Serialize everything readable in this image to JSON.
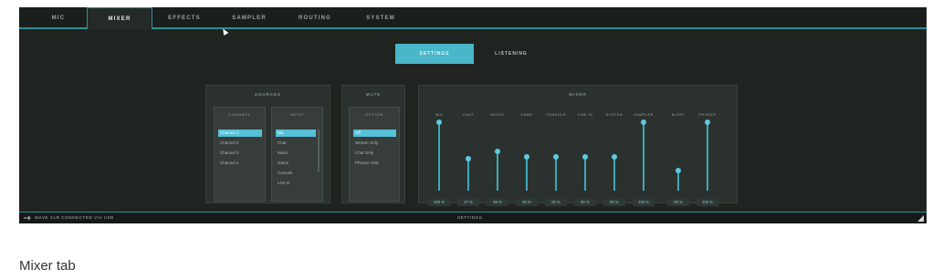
{
  "tabs": [
    {
      "label": "MIC",
      "active": false
    },
    {
      "label": "MIXER",
      "active": true
    },
    {
      "label": "EFFECTS",
      "active": false
    },
    {
      "label": "SAMPLER",
      "active": false
    },
    {
      "label": "ROUTING",
      "active": false
    },
    {
      "label": "SYSTEM",
      "active": false
    }
  ],
  "modes": {
    "settings": "SETTINGS",
    "listening": "LISTENING"
  },
  "panels": {
    "sources": {
      "title": "SOURCES",
      "channel": {
        "title": "CHANNEL",
        "items": [
          "Channel 1",
          "Channel 2",
          "Channel 3",
          "Channel 4"
        ]
      },
      "input": {
        "title": "INPUT",
        "items": [
          "Mic",
          "Chat",
          "Music",
          "Game",
          "Console",
          "Line In"
        ]
      }
    },
    "mute": {
      "title": "MUTE",
      "option": {
        "title": "OPTION",
        "items": [
          "Off",
          "Stream Only",
          "Chat Only",
          "Phones Only"
        ]
      }
    },
    "mixer": {
      "title": "MIXER",
      "channels": [
        {
          "label": "MIC",
          "value": "100 %",
          "level": 1.0
        },
        {
          "label": "CHAT",
          "value": "47 %",
          "level": 0.47
        },
        {
          "label": "MUSIC",
          "value": "58 %",
          "level": 0.58
        },
        {
          "label": "GAME",
          "value": "50 %",
          "level": 0.5
        },
        {
          "label": "CONSOLE",
          "value": "50 %",
          "level": 0.5
        },
        {
          "label": "LINE IN",
          "value": "50 %",
          "level": 0.5
        },
        {
          "label": "SYSTEM",
          "value": "50 %",
          "level": 0.5
        },
        {
          "label": "SAMPLER",
          "value": "100 %",
          "level": 1.0
        },
        {
          "label": "BLEEP",
          "value": "30 %",
          "level": 0.3
        },
        {
          "label": "PHONES",
          "value": "100 %",
          "level": 1.0
        }
      ]
    }
  },
  "status": {
    "left": "WAVE XLR CONNECTED VIA USB",
    "center": "SETTINGS"
  },
  "caption": "Mixer tab"
}
